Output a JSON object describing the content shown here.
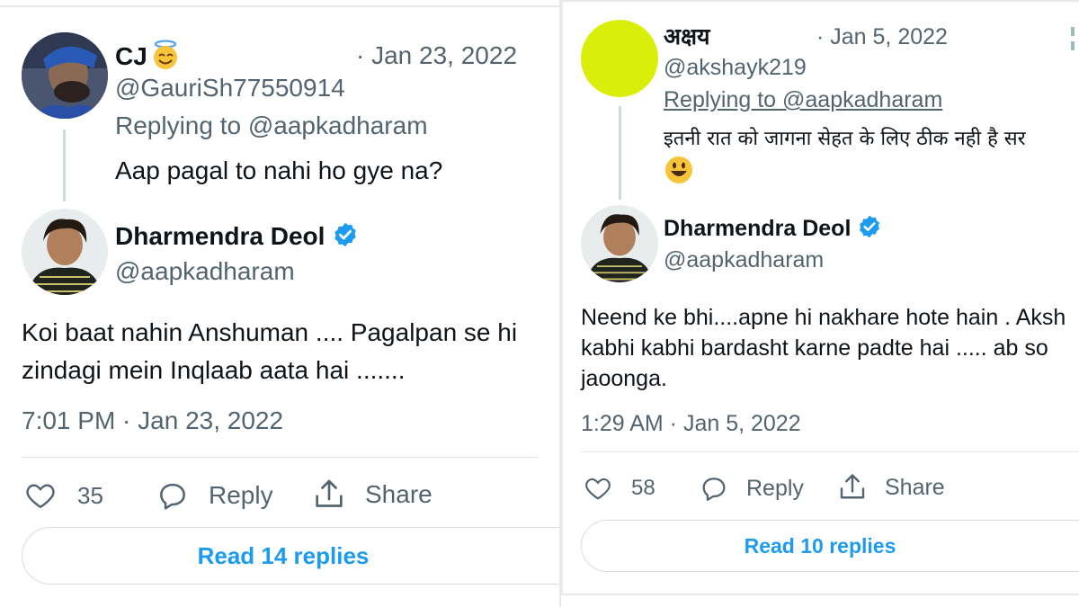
{
  "left": {
    "reply": {
      "name": "CJ",
      "handle": "@GauriSh77550914",
      "date": "· Jan 23, 2022",
      "replying_to": "Replying to @aapkadharam",
      "text": "Aap pagal to nahi ho gye na?"
    },
    "tweet": {
      "name": "Dharmendra Deol",
      "handle": "@aapkadharam",
      "text_line1": "Koi baat nahin Anshuman .... Pagalpan se hi",
      "text_line2": "zindagi mein Inqlaab aata hai .......",
      "timestamp": "7:01 PM · Jan 23, 2022"
    },
    "actions": {
      "likes": "35",
      "reply_label": "Reply",
      "share_label": "Share"
    },
    "read_replies": "Read 14 replies"
  },
  "right": {
    "reply": {
      "name": "अक्षय",
      "handle": "@akshayk219",
      "date": "· Jan 5, 2022",
      "replying_to": "Replying to @aapkadharam",
      "text": "इतनी रात को जागना सेहत के लिए ठीक नही है सर"
    },
    "tweet": {
      "name": "Dharmendra Deol",
      "handle": "@aapkadharam",
      "text_line1": "Neend ke bhi....apne hi nakhare hote hain . Aksh",
      "text_line2": "kabhi kabhi bardasht karne padte hai ..... ab so",
      "text_line3": "jaoonga.",
      "timestamp": "1:29 AM · Jan 5, 2022"
    },
    "actions": {
      "likes": "58",
      "reply_label": "Reply",
      "share_label": "Share"
    },
    "read_replies": "Read 10 replies"
  },
  "colors": {
    "text": "#0f1419",
    "muted": "#536471",
    "accent_blue": "#1d9bf0",
    "thread_line": "#cfd9de",
    "avatar_yellow": "#d9ef0a"
  }
}
